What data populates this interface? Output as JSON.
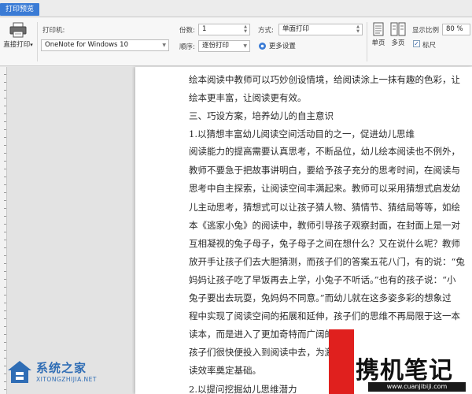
{
  "tab": {
    "label": "打印预览"
  },
  "toolbar": {
    "direct_print_label": "直接打印",
    "direct_print_arrow": "▾",
    "printer_label": "打印机:",
    "printer_value": "OneNote for Windows 10",
    "copies_label": "份数:",
    "copies_value": "1",
    "order_label": "顺序:",
    "order_value": "逐份打印",
    "mode_label": "方式:",
    "mode_value": "单面打印",
    "more_settings_label": "更多设置",
    "single_page_label": "单页",
    "multi_page_label": "多页",
    "zoom_label": "显示比例",
    "zoom_value": "80 %",
    "ruler_label": "标尺",
    "ruler_checked": "✓"
  },
  "document": {
    "lines": [
      "绘本阅读中教师可以巧妙创设情境，给阅读涂上一抹有趣的色彩，让",
      "绘本更丰富，让阅读更有效。",
      "三、巧设方案，培养幼儿的自主意识",
      "1.以猜想丰富幼儿阅读空间活动目的之一，促进幼儿思维",
      "阅读能力的提高需要认真思考，不断品位，幼儿绘本阅读也不例外，",
      "教师不要急于把故事讲明白，要给予孩子充分的思考时间，在阅读与",
      "思考中自主探索，让阅读空间丰满起来。教师可以采用猜想式启发幼",
      "儿主动思考，猜想式可以让孩子猜人物、猜情节、猜结局等等，如绘",
      "本《逃家小兔》的阅读中，教师引导孩子观察封面，在封面上是一对",
      "互相凝视的兔子母子，兔子母子之间在想什么？又在说什么呢？教师",
      "放开手让孩子们去大胆猜测，而孩子们的答案五花八门，有的说：“兔",
      "妈妈让孩子吃了早饭再去上学，小兔子不听话。”也有的孩子说：“小",
      "兔子要出去玩耍，兔妈妈不同意。”而幼儿就在这多姿多彩的想象过",
      "程中实现了阅读空间的拓展和延伸，孩子们的思维不再局限于这一本",
      "读本，而是进入了更加奇特而广阔的空",
      "孩子们很快便投入到阅读中去，为激发",
      "读效率奠定基础。",
      "2.以提问挖掘幼儿思维潜力"
    ]
  },
  "watermarks": {
    "left_title": "系统之家",
    "left_sub": "XITONGZHIJIA.NET",
    "right_title": "携机笔记",
    "right_sub": "www.cuanjibiji.com"
  },
  "colors": {
    "accent": "#3a7bd5",
    "watermark_red": "#e0201e",
    "watermark_blue": "#2f6db5"
  }
}
